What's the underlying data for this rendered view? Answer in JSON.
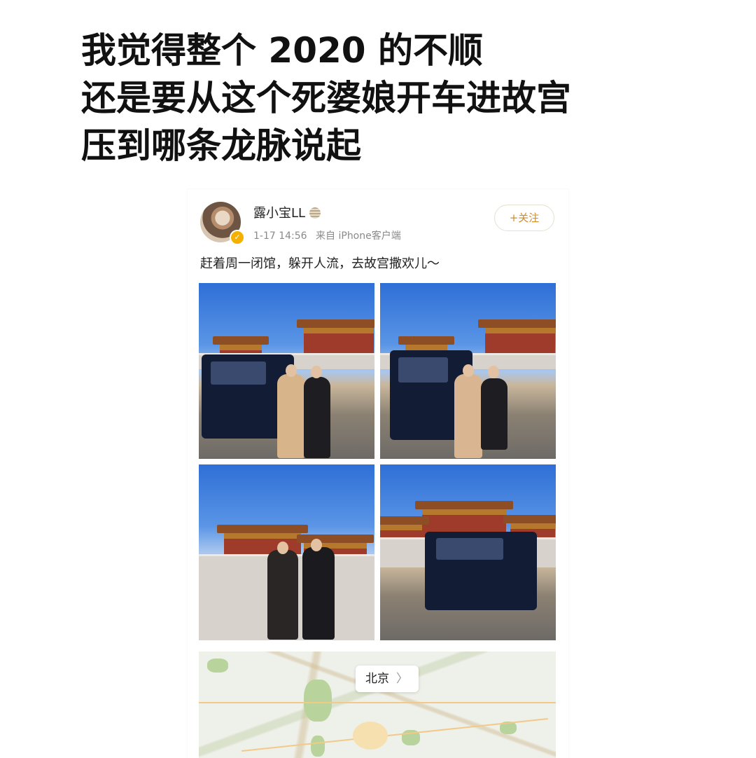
{
  "caption": {
    "lines": [
      "我觉得整个 2020 的不顺",
      "还是要从这个死婆娘开车进故宫",
      "压到哪条龙脉说起"
    ]
  },
  "post": {
    "username": "露小宝LL",
    "timestamp": "1-17 14:56",
    "source": "来自 iPhone客户端",
    "follow_label": "+关注",
    "text": "赶着周一闭馆，躲开人流，去故宫撒欢儿～",
    "map_location": "北京",
    "map_chevron": "〉"
  }
}
